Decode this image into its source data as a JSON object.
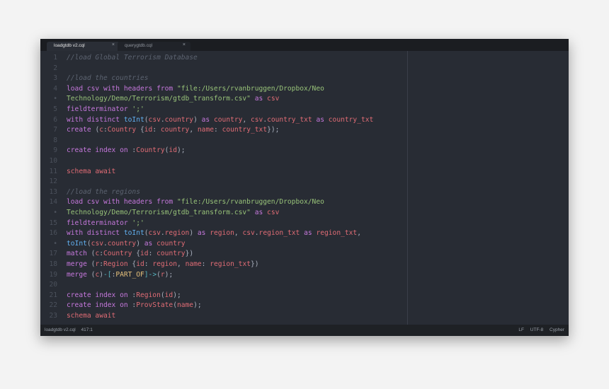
{
  "tabs": [
    {
      "label": "loadgtdb v2.cql",
      "close": "×"
    },
    {
      "label": "querygtdb.cql",
      "close": "×"
    }
  ],
  "status": {
    "filename": "loadgtdb v2.cql",
    "position": "417:1",
    "line_ending": "LF",
    "encoding": "UTF-8",
    "syntax": "Cypher"
  },
  "lines": [
    {
      "n": "1",
      "t": [
        [
          "c",
          "//load Global Terrorism Database"
        ]
      ]
    },
    {
      "n": "2",
      "t": []
    },
    {
      "n": "3",
      "t": [
        [
          "c",
          "//load the countries"
        ]
      ]
    },
    {
      "n": "4",
      "t": [
        [
          "k",
          "load csv with headers from "
        ],
        [
          "s",
          "\"file:/Users/rvanbruggen/Dropbox/Neo"
        ]
      ]
    },
    {
      "n": "•",
      "t": [
        [
          "s",
          "Technology/Demo/Terrorism/gtdb_transform.csv\""
        ],
        [
          "p",
          " "
        ],
        [
          "k",
          "as"
        ],
        [
          "p",
          " "
        ],
        [
          "v",
          "csv"
        ]
      ]
    },
    {
      "n": "5",
      "t": [
        [
          "k",
          "fieldterminator "
        ],
        [
          "s",
          "';'"
        ]
      ]
    },
    {
      "n": "6",
      "t": [
        [
          "k",
          "with distinct "
        ],
        [
          "f",
          "toInt"
        ],
        [
          "p",
          "("
        ],
        [
          "v",
          "csv"
        ],
        [
          "p",
          "."
        ],
        [
          "v",
          "country"
        ],
        [
          "p",
          ") "
        ],
        [
          "k",
          "as"
        ],
        [
          "p",
          " "
        ],
        [
          "v",
          "country"
        ],
        [
          "p",
          ", "
        ],
        [
          "v",
          "csv"
        ],
        [
          "p",
          "."
        ],
        [
          "v",
          "country_txt"
        ],
        [
          "p",
          " "
        ],
        [
          "k",
          "as"
        ],
        [
          "p",
          " "
        ],
        [
          "v",
          "country_txt"
        ]
      ]
    },
    {
      "n": "7",
      "t": [
        [
          "k",
          "create "
        ],
        [
          "p",
          "("
        ],
        [
          "v",
          "c"
        ],
        [
          "p",
          ":"
        ],
        [
          "l",
          "Country"
        ],
        [
          "p",
          " {"
        ],
        [
          "v",
          "id"
        ],
        [
          "p",
          ": "
        ],
        [
          "v",
          "country"
        ],
        [
          "p",
          ", "
        ],
        [
          "v",
          "name"
        ],
        [
          "p",
          ": "
        ],
        [
          "v",
          "country_txt"
        ],
        [
          "p",
          "});"
        ]
      ]
    },
    {
      "n": "8",
      "t": []
    },
    {
      "n": "9",
      "t": [
        [
          "k",
          "create index on "
        ],
        [
          "p",
          ":"
        ],
        [
          "l",
          "Country"
        ],
        [
          "p",
          "("
        ],
        [
          "v",
          "id"
        ],
        [
          "p",
          ");"
        ]
      ]
    },
    {
      "n": "10",
      "t": []
    },
    {
      "n": "11",
      "t": [
        [
          "v",
          "schema await"
        ]
      ]
    },
    {
      "n": "12",
      "t": []
    },
    {
      "n": "13",
      "t": [
        [
          "c",
          "//load the regions"
        ]
      ]
    },
    {
      "n": "14",
      "t": [
        [
          "k",
          "load csv with headers from "
        ],
        [
          "s",
          "\"file:/Users/rvanbruggen/Dropbox/Neo"
        ]
      ]
    },
    {
      "n": "•",
      "t": [
        [
          "s",
          "Technology/Demo/Terrorism/gtdb_transform.csv\""
        ],
        [
          "p",
          " "
        ],
        [
          "k",
          "as"
        ],
        [
          "p",
          " "
        ],
        [
          "v",
          "csv"
        ]
      ]
    },
    {
      "n": "15",
      "t": [
        [
          "k",
          "fieldterminator "
        ],
        [
          "s",
          "';'"
        ]
      ]
    },
    {
      "n": "16",
      "t": [
        [
          "k",
          "with distinct "
        ],
        [
          "f",
          "toInt"
        ],
        [
          "p",
          "("
        ],
        [
          "v",
          "csv"
        ],
        [
          "p",
          "."
        ],
        [
          "v",
          "region"
        ],
        [
          "p",
          ") "
        ],
        [
          "k",
          "as"
        ],
        [
          "p",
          " "
        ],
        [
          "v",
          "region"
        ],
        [
          "p",
          ", "
        ],
        [
          "v",
          "csv"
        ],
        [
          "p",
          "."
        ],
        [
          "v",
          "region_txt"
        ],
        [
          "p",
          " "
        ],
        [
          "k",
          "as"
        ],
        [
          "p",
          " "
        ],
        [
          "v",
          "region_txt"
        ],
        [
          "p",
          ","
        ]
      ]
    },
    {
      "n": "•",
      "t": [
        [
          "f",
          "toInt"
        ],
        [
          "p",
          "("
        ],
        [
          "v",
          "csv"
        ],
        [
          "p",
          "."
        ],
        [
          "v",
          "country"
        ],
        [
          "p",
          ") "
        ],
        [
          "k",
          "as"
        ],
        [
          "p",
          " "
        ],
        [
          "v",
          "country"
        ]
      ]
    },
    {
      "n": "17",
      "t": [
        [
          "k",
          "match "
        ],
        [
          "p",
          "("
        ],
        [
          "v",
          "c"
        ],
        [
          "p",
          ":"
        ],
        [
          "l",
          "Country"
        ],
        [
          "p",
          " {"
        ],
        [
          "v",
          "id"
        ],
        [
          "p",
          ": "
        ],
        [
          "v",
          "country"
        ],
        [
          "p",
          "})"
        ]
      ]
    },
    {
      "n": "18",
      "t": [
        [
          "k",
          "merge "
        ],
        [
          "p",
          "("
        ],
        [
          "v",
          "r"
        ],
        [
          "p",
          ":"
        ],
        [
          "l",
          "Region"
        ],
        [
          "p",
          " {"
        ],
        [
          "v",
          "id"
        ],
        [
          "p",
          ": "
        ],
        [
          "v",
          "region"
        ],
        [
          "p",
          ", "
        ],
        [
          "v",
          "name"
        ],
        [
          "p",
          ": "
        ],
        [
          "v",
          "region_txt"
        ],
        [
          "p",
          "})"
        ]
      ]
    },
    {
      "n": "19",
      "t": [
        [
          "k",
          "merge "
        ],
        [
          "p",
          "("
        ],
        [
          "v",
          "c"
        ],
        [
          "p",
          ")"
        ],
        [
          "o",
          "-["
        ],
        [
          "p",
          ":"
        ],
        [
          "y",
          "PART_OF"
        ],
        [
          "o",
          "]->"
        ],
        [
          "p",
          "("
        ],
        [
          "v",
          "r"
        ],
        [
          "p",
          ");"
        ]
      ]
    },
    {
      "n": "20",
      "t": []
    },
    {
      "n": "21",
      "t": [
        [
          "k",
          "create index on "
        ],
        [
          "p",
          ":"
        ],
        [
          "l",
          "Region"
        ],
        [
          "p",
          "("
        ],
        [
          "v",
          "id"
        ],
        [
          "p",
          ");"
        ]
      ]
    },
    {
      "n": "22",
      "t": [
        [
          "k",
          "create index on "
        ],
        [
          "p",
          ":"
        ],
        [
          "l",
          "ProvState"
        ],
        [
          "p",
          "("
        ],
        [
          "v",
          "name"
        ],
        [
          "p",
          ");"
        ]
      ]
    },
    {
      "n": "23",
      "t": [
        [
          "v",
          "schema await"
        ]
      ]
    }
  ]
}
